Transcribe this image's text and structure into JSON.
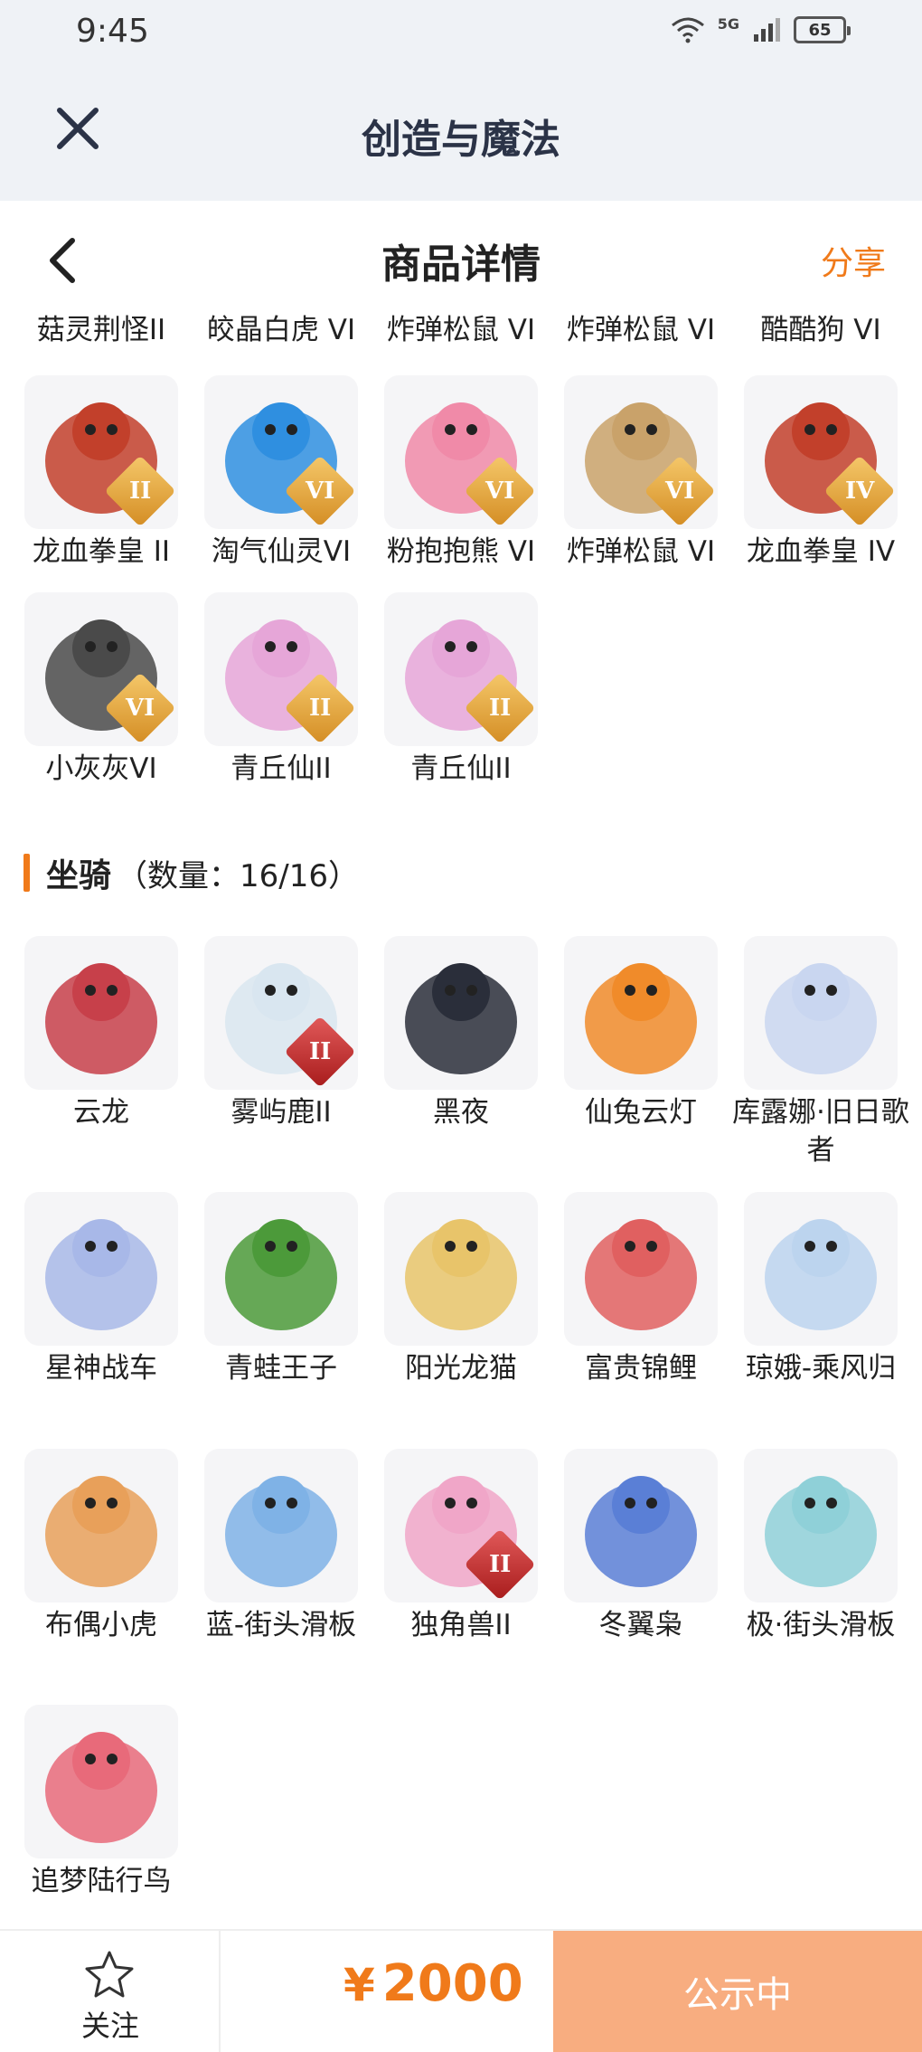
{
  "status_bar": {
    "time": "9:45",
    "network": "5G",
    "battery": "65"
  },
  "header": {
    "title": "创造与魔法"
  },
  "nav": {
    "title": "商品详情",
    "share": "分享"
  },
  "top_row_labels": [
    "菇灵荆怪II",
    "皎晶白虎 VI",
    "炸弹松鼠 VI",
    "炸弹松鼠 VI",
    "酷酷狗 VI"
  ],
  "pets": [
    {
      "name": "龙血拳皇 II",
      "badge": "II",
      "color": "#c2402b"
    },
    {
      "name": "淘气仙灵VI",
      "badge": "VI",
      "color": "#2f8fe0"
    },
    {
      "name": "粉抱抱熊 VI",
      "badge": "VI",
      "color": "#f08aa8"
    },
    {
      "name": "炸弹松鼠 VI",
      "badge": "VI",
      "color": "#c9a26a"
    },
    {
      "name": "龙血拳皇 IV",
      "badge": "IV",
      "color": "#c2402b"
    },
    {
      "name": "小灰灰VI",
      "badge": "VI",
      "color": "#4a4a4a"
    },
    {
      "name": "青丘仙II",
      "badge": "II",
      "color": "#e6a6d8"
    },
    {
      "name": "青丘仙II",
      "badge": "II",
      "color": "#e6a6d8"
    }
  ],
  "mounts_section": {
    "name": "坐骑",
    "count": "（数量：16/16）"
  },
  "mounts": [
    {
      "name": "云龙",
      "badge": "",
      "color": "#c7404a"
    },
    {
      "name": "雾屿鹿II",
      "badge": "II",
      "color": "#d9e6f0"
    },
    {
      "name": "黑夜",
      "badge": "",
      "color": "#2a2e3a"
    },
    {
      "name": "仙兔云灯",
      "badge": "",
      "color": "#f08b2a"
    },
    {
      "name": "库露娜·旧日歌者",
      "badge": "",
      "color": "#c9d6f0"
    },
    {
      "name": "星神战车",
      "badge": "",
      "color": "#a8b8e8"
    },
    {
      "name": "青蛙王子",
      "badge": "",
      "color": "#4c9a3a"
    },
    {
      "name": "阳光龙猫",
      "badge": "",
      "color": "#e8c46a"
    },
    {
      "name": "富贵锦鲤",
      "badge": "",
      "color": "#e06060"
    },
    {
      "name": "琼娥-乘风归",
      "badge": "",
      "color": "#bcd4ee"
    },
    {
      "name": "布偶小虎",
      "badge": "",
      "color": "#e8a05a"
    },
    {
      "name": "蓝-街头滑板",
      "badge": "",
      "color": "#7fb2e6"
    },
    {
      "name": "独角兽II",
      "badge": "II",
      "color": "#f0a6c8"
    },
    {
      "name": "冬翼枭",
      "badge": "",
      "color": "#5a7fd6"
    },
    {
      "name": "极·街头滑板",
      "badge": "",
      "color": "#8fd0d8"
    },
    {
      "name": "追梦陆行鸟",
      "badge": "",
      "color": "#e86a7a"
    }
  ],
  "bottom": {
    "follow": "关注",
    "currency": "¥",
    "price": "2000",
    "status": "公示中"
  },
  "colors": {
    "accent": "#f07a1a",
    "status_button": "#f8ad80"
  }
}
